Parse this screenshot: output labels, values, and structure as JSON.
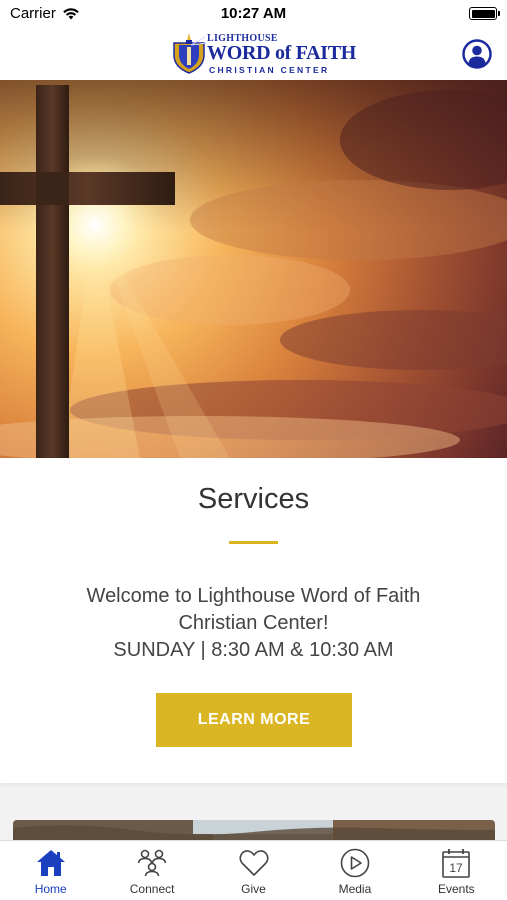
{
  "status_bar": {
    "carrier": "Carrier",
    "time": "10:27 AM"
  },
  "header": {
    "logo": {
      "line1": "LIGHTHOUSE",
      "line2": "WORD of FAITH",
      "line3": "CHRISTIAN CENTER"
    },
    "profile_icon": "profile-icon"
  },
  "hero": {
    "image": "cross-at-sunset"
  },
  "services": {
    "title": "Services",
    "text_line1": "Welcome to Lighthouse Word of Faith",
    "text_line2": "Christian Center!",
    "text_line3": "SUNDAY | 8:30 AM & 10:30 AM",
    "button_label": "LEARN MORE"
  },
  "tabs": [
    {
      "label": "Home",
      "icon": "home-icon",
      "active": true
    },
    {
      "label": "Connect",
      "icon": "connect-icon",
      "active": false
    },
    {
      "label": "Give",
      "icon": "heart-icon",
      "active": false
    },
    {
      "label": "Media",
      "icon": "play-icon",
      "active": false
    },
    {
      "label": "Events",
      "icon": "calendar-icon",
      "active": false
    }
  ],
  "calendar_day": "17",
  "colors": {
    "accent_gold": "#dbb624",
    "brand_blue": "#1b2a9c",
    "active_tab": "#1a3fbf"
  }
}
